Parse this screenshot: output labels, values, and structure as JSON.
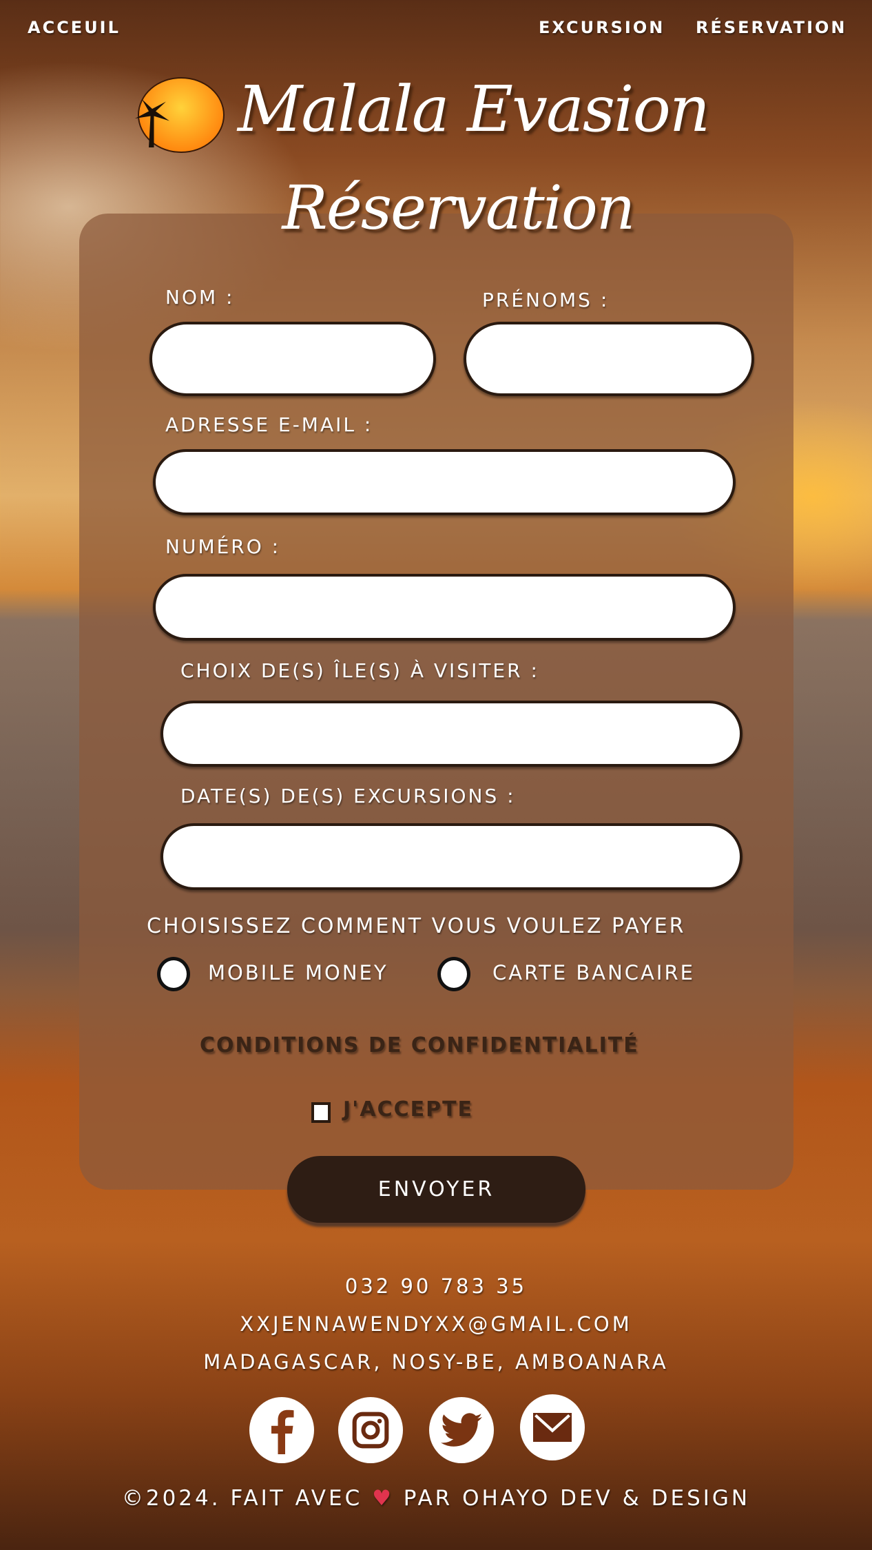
{
  "nav": {
    "home": "ACCEUIL",
    "excursion": "EXCURSION",
    "reservation": "RÉSERVATION"
  },
  "header": {
    "brand": "Malala Evasion",
    "logo_text": "MALALA EVASION",
    "page_title": "Réservation"
  },
  "form": {
    "nom_label": "NOM :",
    "prenoms_label": "PRÉNOMS :",
    "email_label": "ADRESSE E-MAIL :",
    "numero_label": "NUMÉRO :",
    "iles_label": "CHOIX DE(S) ÎLE(S) À VISITER :",
    "dates_label": "DATE(S) DE(S) EXCURSIONS :",
    "nom": "",
    "prenoms": "",
    "email": "",
    "numero": "",
    "iles": "",
    "dates": "",
    "payment_prompt": "CHOISISSEZ COMMENT VOUS VOULEZ PAYER",
    "payment_options": [
      "MOBILE MONEY",
      "CARTE BANCAIRE"
    ],
    "conditions": "CONDITIONS DE CONFIDENTIALITÉ",
    "accept_label": "J'ACCEPTE",
    "accept_checked": false,
    "submit": "ENVOYER"
  },
  "footer": {
    "phone": "032 90 783 35",
    "email": "XXJENNAWENDYXX@GMAIL.COM",
    "address": "MADAGASCAR, NOSY-BE, AMBOANARA",
    "social": [
      "facebook-icon",
      "instagram-icon",
      "twitter-icon",
      "mail-icon"
    ],
    "copyright_pre": "©2024. FAIT AVEC",
    "copyright_post": "PAR OHAYO DEV & DESIGN",
    "heart_color": "#e0344e"
  },
  "colors": {
    "card": "#8c5a3c",
    "button": "#2e1d14",
    "input_border": "#2a1a10"
  }
}
